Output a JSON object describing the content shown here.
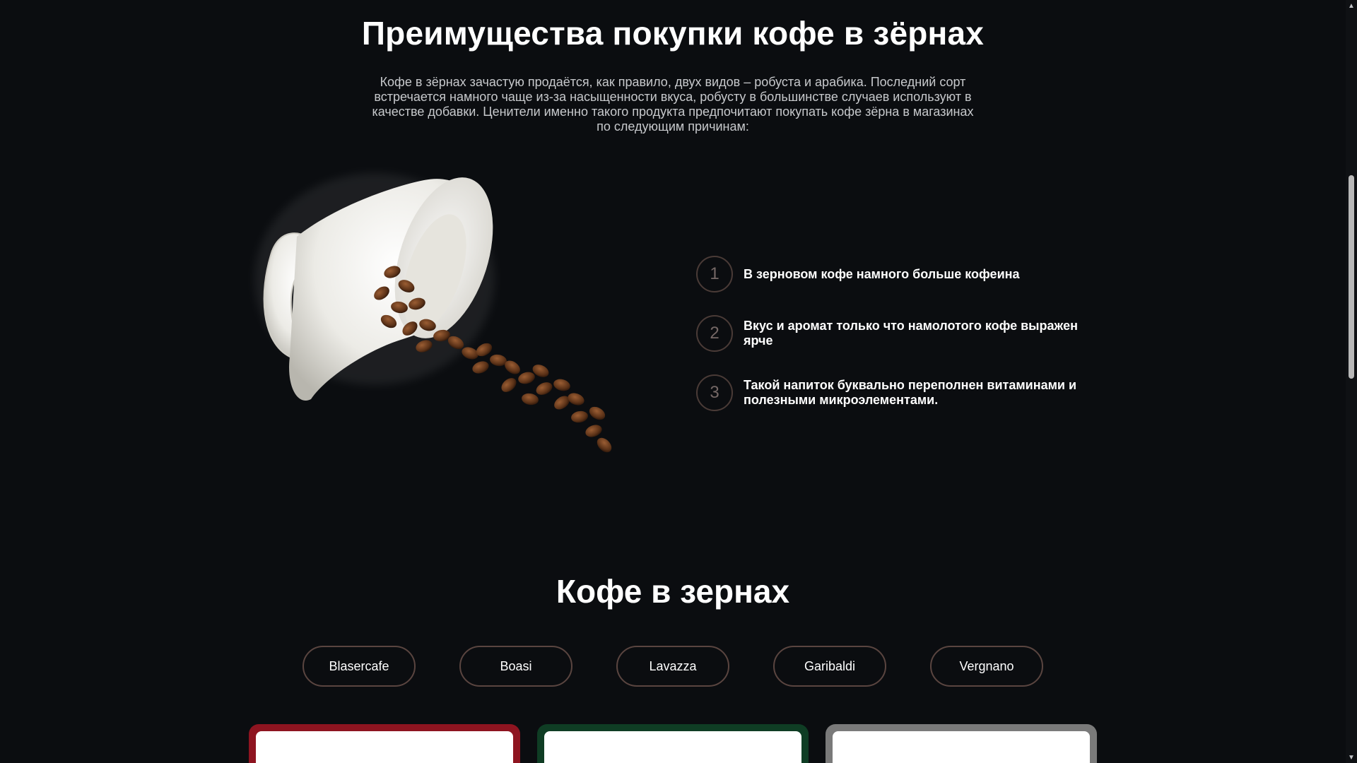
{
  "section_benefits": {
    "title": "Преимущества покупки кофе в зёрнах",
    "intro": "Кофе в зёрнах зачастую продаётся, как правило, двух видов – робуста и арабика. Последний сорт встречается намного чаще из-за насыщенности вкуса, робусту в большинстве случаев используют в качестве добавки. Ценители именно такого продукта предпочитают покупать кофе зёрна в магазинах по следующим причинам:",
    "image_icon": "coffee-cup-with-spilled-beans",
    "items": [
      {
        "num": "1",
        "text": "В зерновом кофе намного больше кофеина"
      },
      {
        "num": "2",
        "text": "Вкус и аромат только что намолотого кофе выражен ярче"
      },
      {
        "num": "3",
        "text": "Такой напиток буквально переполнен витаминами и полезными микроэлементами."
      }
    ]
  },
  "section_catalog": {
    "title": "Кофе в зернах",
    "tabs": [
      "Blasercafe",
      "Boasi",
      "Lavazza",
      "Garibaldi",
      "Vergnano"
    ],
    "cards": [
      {
        "border_color": "#8e1420",
        "package_color": "#b0142a"
      },
      {
        "border_color": "#0f3d24",
        "package_color": "#1f5d4a"
      },
      {
        "border_color": "#7a7a7a",
        "package_color": "#1a1a1a"
      }
    ]
  },
  "colors": {
    "background": "#0b0d10",
    "accent_border": "#5a4540",
    "number_color": "#756866"
  }
}
